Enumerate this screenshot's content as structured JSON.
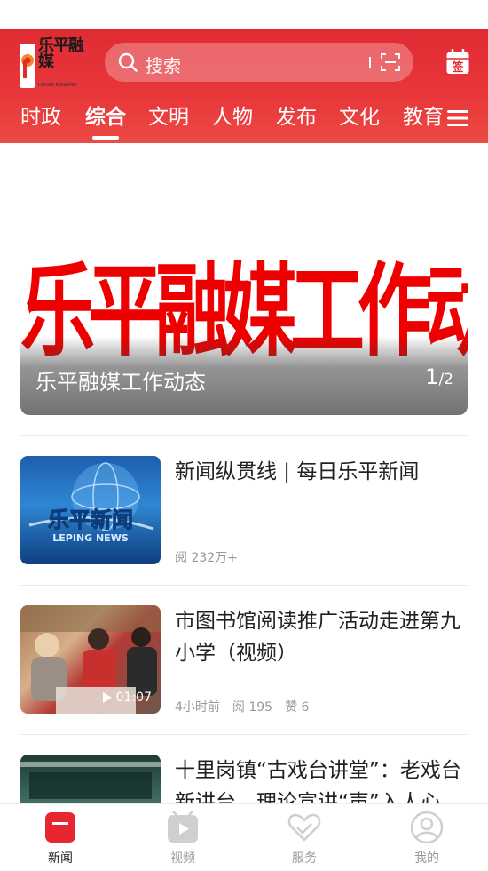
{
  "header": {
    "logo_text": "乐平融媒",
    "logo_sub": "LEPING RONGMEI",
    "search_placeholder": "搜索",
    "sign_label": "签"
  },
  "tabs": [
    {
      "label": "时政"
    },
    {
      "label": "综合",
      "active": true
    },
    {
      "label": "文明"
    },
    {
      "label": "人物"
    },
    {
      "label": "发布"
    },
    {
      "label": "文化"
    },
    {
      "label": "教育"
    }
  ],
  "banner": {
    "image_text": "乐平融媒工作动态",
    "caption": "乐平融媒工作动态",
    "page_current": "1",
    "page_total": "/2"
  },
  "news": [
    {
      "title": "新闻纵贯线 | 每日乐平新闻",
      "thumb_text": "乐平新闻",
      "thumb_sub": "LEPING NEWS",
      "reads": "阅 232万+"
    },
    {
      "title": "市图书馆阅读推广活动走进第九小学（视频）",
      "time": "4小时前",
      "reads": "阅 195",
      "likes": "赞 6",
      "duration": "01:07"
    },
    {
      "title": "十里岗镇“古戏台讲堂”：老戏台新讲台，理论宣讲“声”入人心"
    }
  ],
  "bottom_nav": [
    {
      "label": "新闻",
      "icon": "news-icon",
      "active": true
    },
    {
      "label": "视频",
      "icon": "video-icon"
    },
    {
      "label": "服务",
      "icon": "service-icon"
    },
    {
      "label": "我的",
      "icon": "profile-icon"
    }
  ],
  "colors": {
    "brand_red": "#e12b33",
    "muted": "#999999"
  }
}
